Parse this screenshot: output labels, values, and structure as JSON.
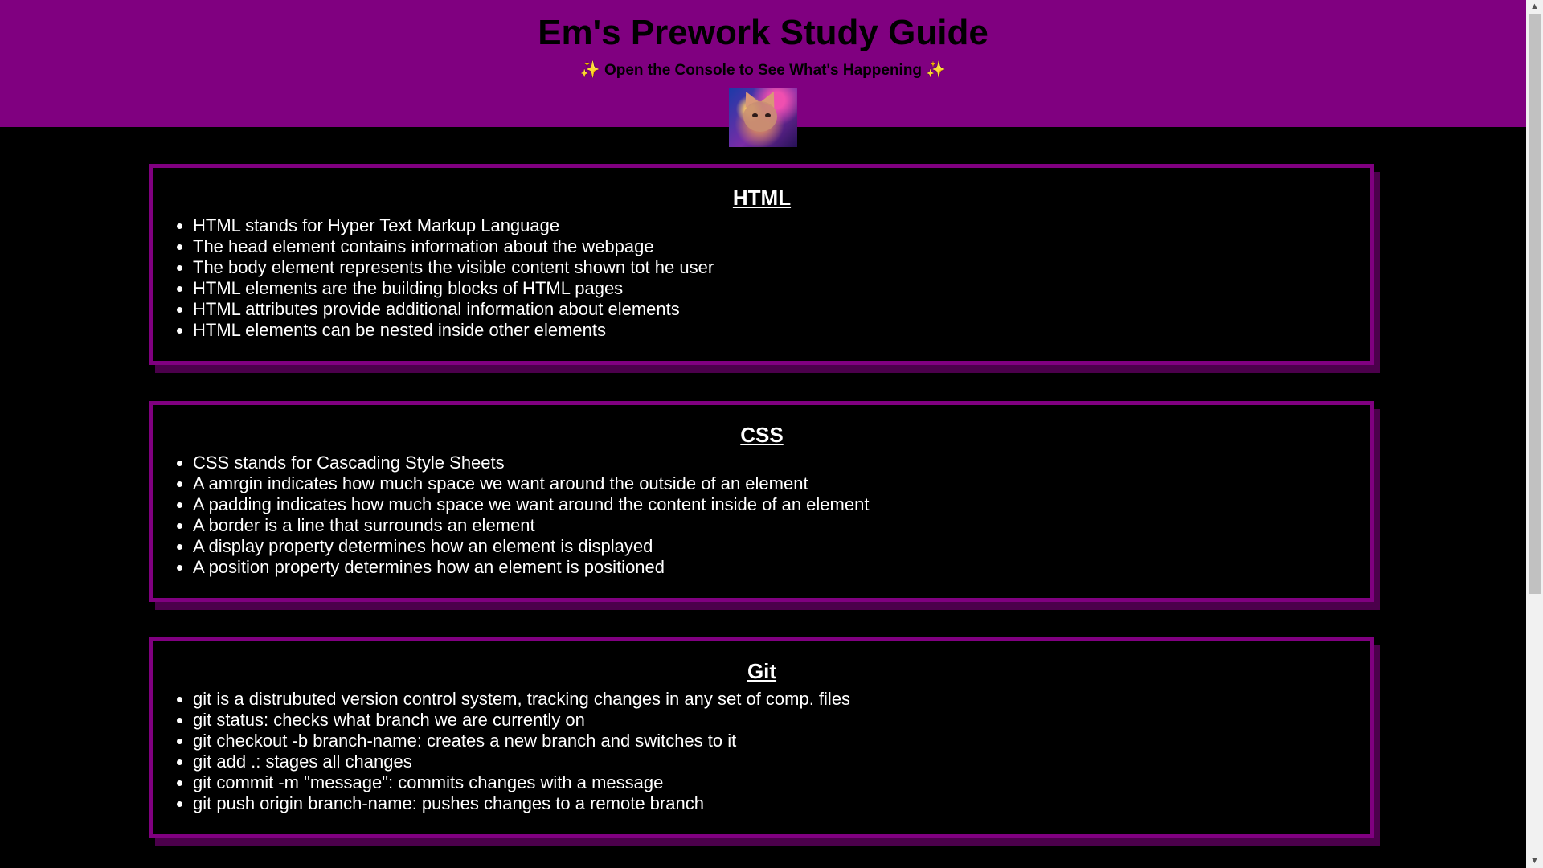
{
  "header": {
    "title": "Em's Prework Study Guide",
    "subtitle_left_icon": "✨",
    "subtitle": "Open the Console to See What's Happening",
    "subtitle_right_icon": "✨"
  },
  "sections": [
    {
      "title": "HTML",
      "items": [
        "HTML stands for Hyper Text Markup Language",
        "The head element contains information about the webpage",
        "The body element represents the visible content shown tot he user",
        "HTML elements are the building blocks of HTML pages",
        "HTML attributes provide additional information about elements",
        "HTML elements can be nested inside other elements"
      ]
    },
    {
      "title": "CSS",
      "items": [
        "CSS stands for Cascading Style Sheets",
        "A amrgin indicates how much space we want around the outside of an element",
        "A padding indicates how much space we want around the content inside of an element",
        "A border is a line that surrounds an element",
        "A display property determines how an element is displayed",
        "A position property determines how an element is positioned"
      ]
    },
    {
      "title": "Git",
      "items": [
        "git is a distrubuted version control system, tracking changes in any set of comp. files",
        "git status: checks what branch we are currently on",
        "git checkout -b branch-name: creates a new branch and switches to it",
        "git add .: stages all changes",
        "git commit -m \"message\": commits changes with a message",
        "git push origin branch-name: pushes changes to a remote branch"
      ]
    }
  ],
  "colors": {
    "header_bg": "#800080",
    "page_bg": "#000000",
    "text": "#ffffff"
  },
  "scrollbar": {
    "up_icon": "▲",
    "down_icon": "▼"
  }
}
